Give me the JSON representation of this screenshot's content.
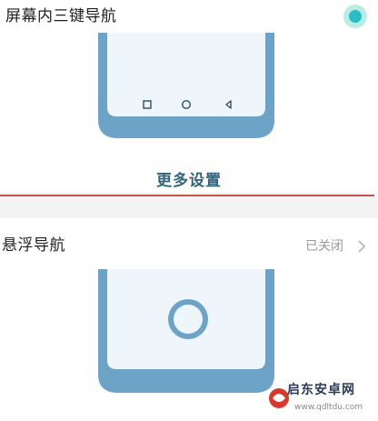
{
  "three_key_nav": {
    "title": "屏幕内三键导航",
    "selected": true,
    "nav_icons": [
      "square-icon",
      "circle-icon",
      "triangle-back-icon"
    ],
    "more_settings_label": "更多设置"
  },
  "floating_nav": {
    "title": "悬浮导航",
    "status": "已关闭",
    "status_icon": "chevron-right-icon"
  },
  "watermark": {
    "text": "启东安卓网",
    "url": "www.qdltdu.com"
  },
  "colors": {
    "accent": "#2bbcc8",
    "phone_frame": "#6ea3c8",
    "phone_screen": "#eef6fb",
    "link": "#35657e",
    "divider": "#c9524f",
    "status_text": "#999999",
    "watermark_red": "#d63a2f"
  }
}
